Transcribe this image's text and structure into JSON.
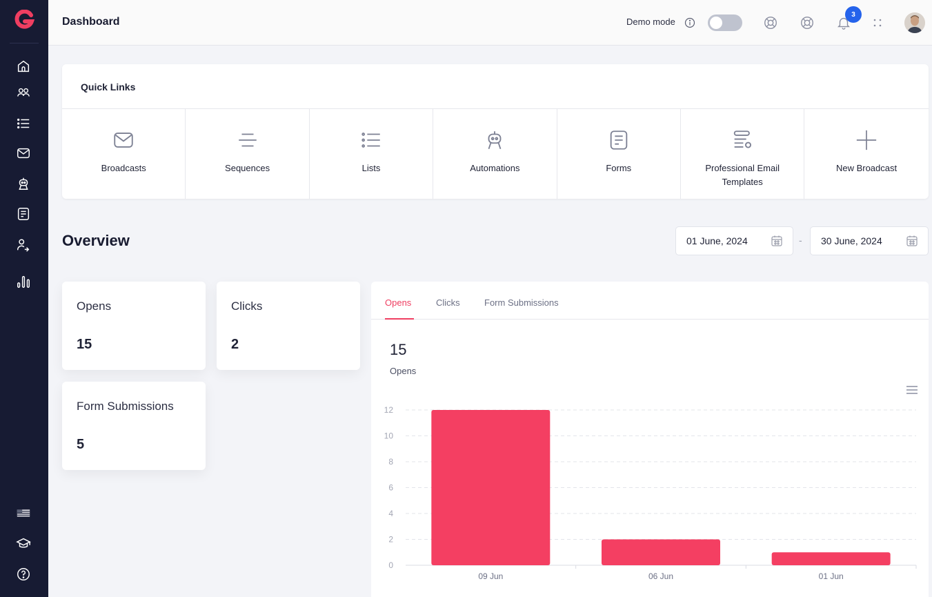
{
  "header": {
    "title": "Dashboard",
    "demo_mode_label": "Demo mode",
    "notification_count": "3"
  },
  "sidebar": {
    "items": [
      {
        "icon": "home-icon"
      },
      {
        "icon": "contacts-icon"
      },
      {
        "icon": "list-icon"
      },
      {
        "icon": "mail-icon"
      },
      {
        "icon": "robot-icon"
      },
      {
        "icon": "form-icon"
      },
      {
        "icon": "user-share-icon"
      },
      {
        "icon": "bar-chart-icon"
      }
    ],
    "bottom_items": [
      {
        "icon": "us-flag-icon"
      },
      {
        "icon": "graduation-cap-icon"
      },
      {
        "icon": "help-icon"
      }
    ]
  },
  "quick_links": {
    "title": "Quick Links",
    "items": [
      {
        "label": "Broadcasts",
        "icon": "mail-icon"
      },
      {
        "label": "Sequences",
        "icon": "sequence-lines-icon"
      },
      {
        "label": "Lists",
        "icon": "list-icon"
      },
      {
        "label": "Automations",
        "icon": "robot-icon"
      },
      {
        "label": "Forms",
        "icon": "form-icon"
      },
      {
        "label": "Professional Email Templates",
        "icon": "template-icon"
      },
      {
        "label": "New Broadcast",
        "icon": "plus-icon"
      }
    ]
  },
  "overview": {
    "title": "Overview",
    "date_from": "01 June, 2024",
    "date_separator": "-",
    "date_to": "30 June, 2024",
    "stats": [
      {
        "label": "Opens",
        "value": "15"
      },
      {
        "label": "Clicks",
        "value": "2"
      },
      {
        "label": "Form Submissions",
        "value": "5"
      }
    ]
  },
  "chart_panel": {
    "tabs": [
      "Opens",
      "Clicks",
      "Form Submissions"
    ],
    "active_tab": "Opens",
    "total": "15",
    "total_label": "Opens"
  },
  "colors": {
    "accent": "#ef3e61",
    "bar": "#f43f62",
    "sidebar": "#171b33",
    "badge": "#2563eb"
  },
  "chart_data": {
    "type": "bar",
    "categories": [
      "09 Jun",
      "06 Jun",
      "01 Jun"
    ],
    "values": [
      12,
      2,
      1
    ],
    "ylim": [
      0,
      12
    ],
    "yticks": [
      0,
      2,
      4,
      6,
      8,
      10,
      12
    ],
    "grid": true,
    "xlabel": "",
    "ylabel": ""
  }
}
